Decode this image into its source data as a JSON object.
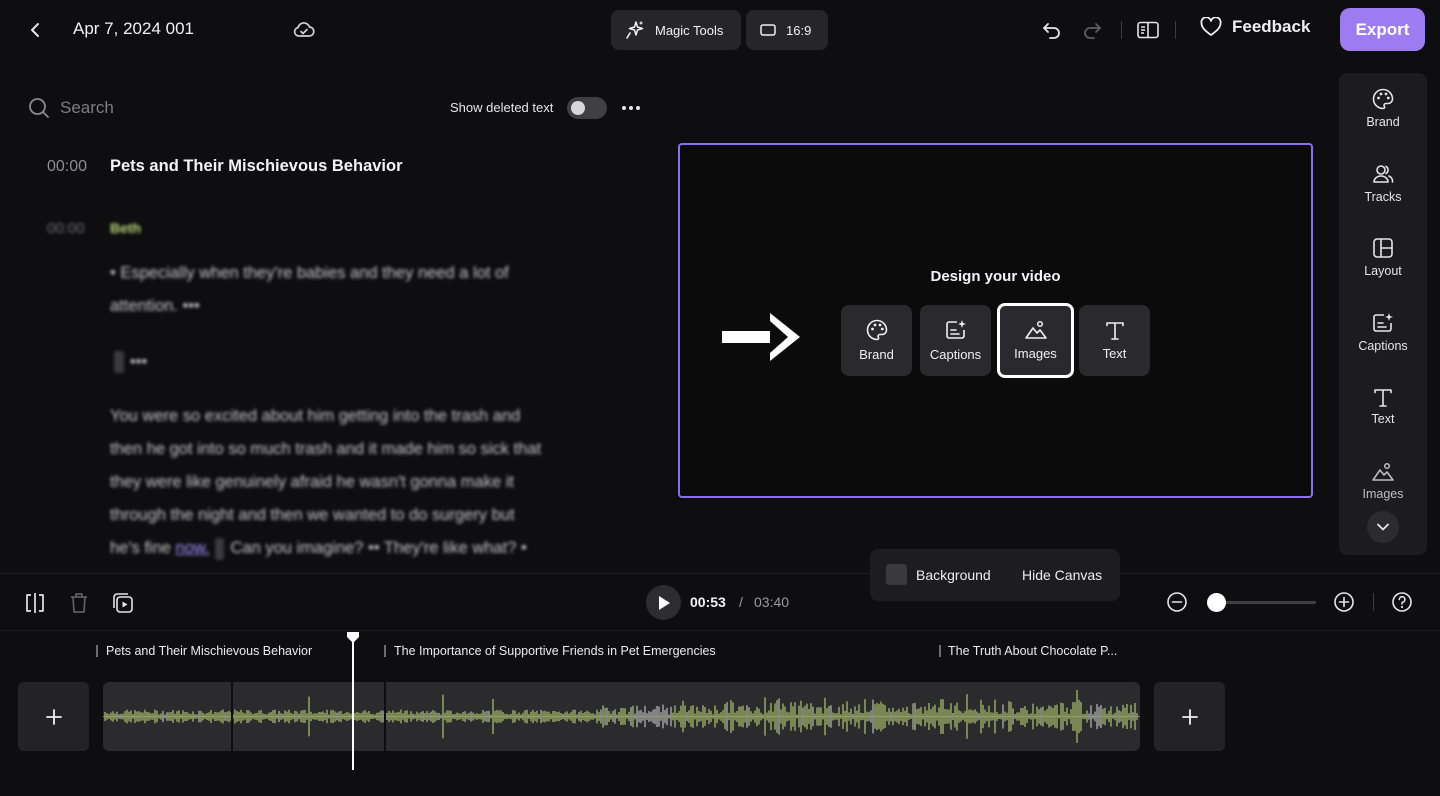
{
  "header": {
    "project_title": "Apr 7, 2024 001",
    "magic_tools_label": "Magic Tools",
    "aspect_ratio_label": "16:9",
    "feedback_label": "Feedback",
    "export_label": "Export"
  },
  "transcript": {
    "search_placeholder": "Search",
    "show_deleted_label": "Show deleted text",
    "show_deleted_on": false,
    "title_time": "00:00",
    "title": "Pets and Their Mischievous Behavior",
    "speaker_time": "00:00",
    "speaker": "Beth",
    "line1": "• Especially when they're babies and they need a lot of",
    "line1b": "attention. •••",
    "gap_marker": "•••",
    "para_lines": [
      "You were so excited about him getting into the trash and",
      "then he got into so much trash and it made him so sick that",
      "they were like genuinely afraid he wasn't gonna make it",
      "through the night and then we wanted to do surgery but"
    ],
    "last_line_start": "he's fine ",
    "last_line_word": "now.",
    "last_line_end": "Can you imagine? •• They're like what? •"
  },
  "canvas": {
    "design_title": "Design your video",
    "cards": [
      {
        "label": "Brand",
        "icon": "palette-icon"
      },
      {
        "label": "Captions",
        "icon": "captions-icon"
      },
      {
        "label": "Images",
        "icon": "image-icon",
        "selected": true
      },
      {
        "label": "Text",
        "icon": "text-icon"
      }
    ],
    "background_label": "Background",
    "hide_canvas_label": "Hide Canvas"
  },
  "rail": {
    "items": [
      {
        "label": "Brand",
        "icon": "palette-icon"
      },
      {
        "label": "Tracks",
        "icon": "tracks-icon"
      },
      {
        "label": "Layout",
        "icon": "layout-icon"
      },
      {
        "label": "Captions",
        "icon": "captions-icon"
      },
      {
        "label": "Text",
        "icon": "text-icon"
      },
      {
        "label": "Images",
        "icon": "image-icon"
      }
    ]
  },
  "playback": {
    "current_time": "00:53",
    "separator": "/",
    "total_time": "03:40",
    "zoom_level": 0
  },
  "timeline": {
    "chapters": [
      "Pets and Their Mischievous Behavior",
      "The Importance of Supportive Friends in Pet Emergencies",
      "The Truth About Chocolate P..."
    ],
    "playhead_fraction": 0.241
  },
  "colors": {
    "accent": "#9d7cf2",
    "speaker": "#b9d97a",
    "waveform": "#c9e37a",
    "waveform_muted": "#d8d8d8"
  }
}
